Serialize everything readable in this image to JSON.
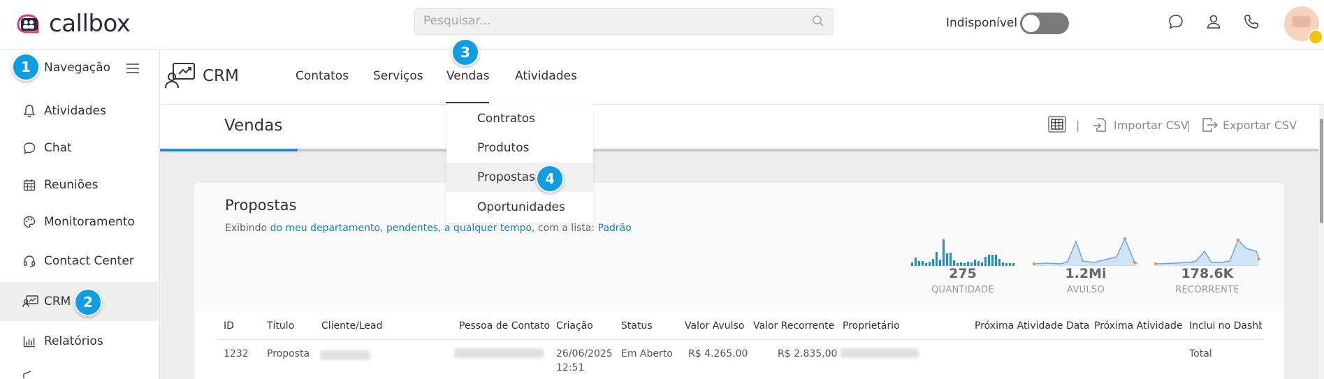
{
  "app": {
    "name": "callbox"
  },
  "search": {
    "placeholder": "Pesquisar..."
  },
  "status": {
    "label": "Indisponível"
  },
  "sidebar": {
    "title": "Navegação",
    "items": [
      {
        "label": "Atividades"
      },
      {
        "label": "Chat"
      },
      {
        "label": "Reuniões"
      },
      {
        "label": "Monitoramento"
      },
      {
        "label": "Contact Center"
      },
      {
        "label": "CRM"
      },
      {
        "label": "Relatórios"
      }
    ]
  },
  "badges": {
    "b1": "1",
    "b2": "2",
    "b3": "3",
    "b4": "4"
  },
  "module": {
    "title": "CRM",
    "tabs": [
      {
        "label": "Contatos"
      },
      {
        "label": "Serviços"
      },
      {
        "label": "Vendas"
      },
      {
        "label": "Atividades"
      }
    ]
  },
  "dropdown": {
    "items": [
      {
        "label": "Contratos"
      },
      {
        "label": "Produtos"
      },
      {
        "label": "Propostas"
      },
      {
        "label": "Oportunidades"
      }
    ]
  },
  "subheader": {
    "title": "Vendas",
    "import_label": "Importar CSV",
    "export_label": "Exportar CSV",
    "separator": "|"
  },
  "card": {
    "title": "Propostas",
    "filter": {
      "prefix": "Exibindo ",
      "dept": "do meu departamento",
      "comma1": ", ",
      "pending": "pendentes",
      "comma2": ", ",
      "time": "a qualquer tempo",
      "list_prefix": ", com a lista: ",
      "list": "Padrão"
    }
  },
  "kpis": [
    {
      "value": "275",
      "label": "QUANTIDADE"
    },
    {
      "value": "1.2Mi",
      "label": "AVULSO"
    },
    {
      "value": "178.6K",
      "label": "RECORRENTE"
    }
  ],
  "table": {
    "headers": [
      "ID",
      "Título",
      "Cliente/Lead",
      "Pessoa de Contato",
      "Criação",
      "Status",
      "Valor Avulso",
      "Valor Recorrente",
      "Proprietário",
      "Próxima Atividade Data",
      "Próxima Atividade",
      "Inclui no Dashbo"
    ],
    "row": {
      "id": "1232",
      "title": "Proposta",
      "date": "26/06/2025",
      "time": "12:51",
      "status": "Em Aberto",
      "avulso": "R$ 4.265,00",
      "recorrente": "R$ 2.835,00",
      "dashboard": "Total"
    }
  },
  "colors": {
    "accent": "#0e9ee8",
    "link": "#1780c6",
    "progress": "#1a8fd6"
  }
}
